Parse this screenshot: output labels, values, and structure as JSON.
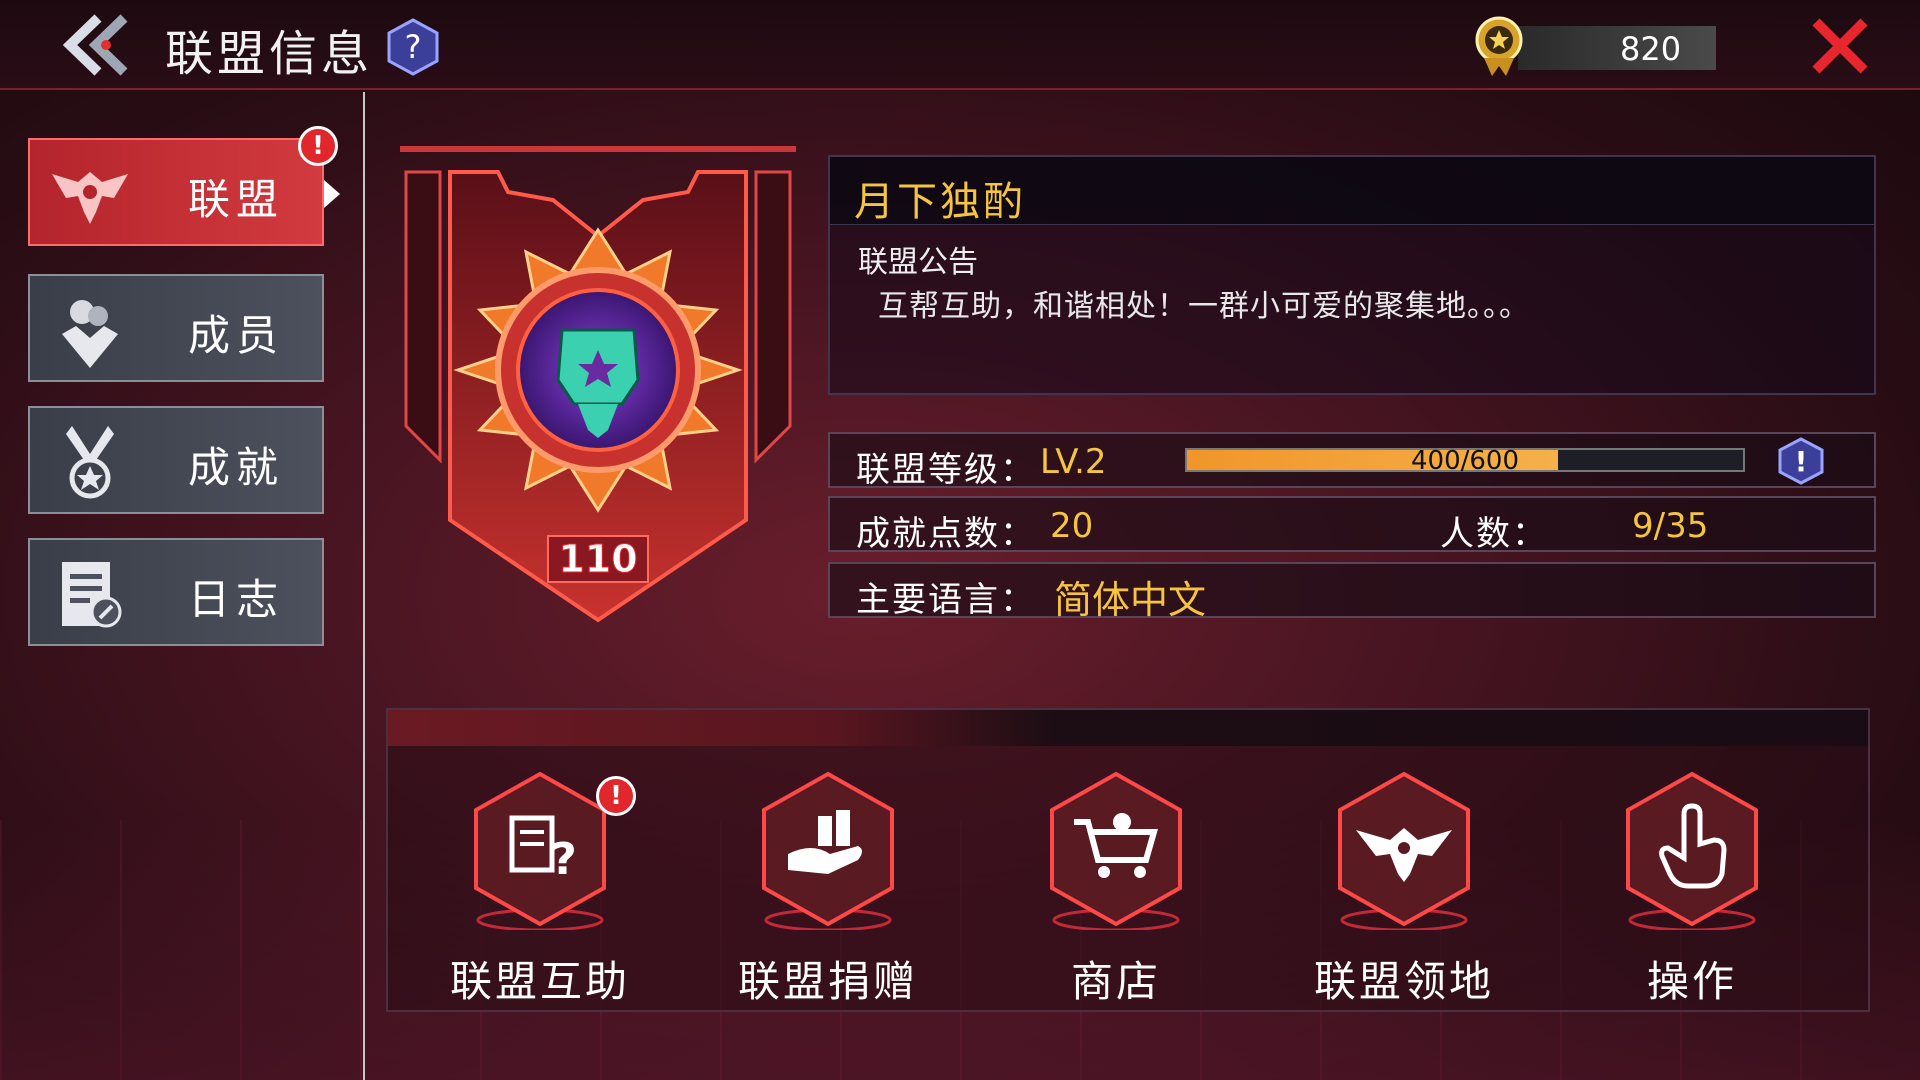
{
  "header": {
    "title": "联盟信息",
    "help_label": "?",
    "currency_value": "820"
  },
  "sidebar": {
    "items": [
      {
        "label": "联盟",
        "active": true,
        "alert": "!"
      },
      {
        "label": "成员",
        "active": false
      },
      {
        "label": "成就",
        "active": false
      },
      {
        "label": "日志",
        "active": false
      }
    ]
  },
  "emblem": {
    "level_text": "110"
  },
  "alliance": {
    "name": "月下独酌",
    "notice_title": "联盟公告",
    "notice_text": "互帮互助，和谐相处！一群小可爱的聚集地。。。",
    "level_label": "联盟等级：",
    "level_value": "LV.2",
    "exp_text": "400/600",
    "exp_progress": 0.667,
    "achievement_label": "成就点数：",
    "achievement_value": "20",
    "members_label": "人数：",
    "members_value": "9/35",
    "language_label": "主要语言：",
    "language_value": "简体中文",
    "info_icon_label": "!"
  },
  "actions": [
    {
      "label": "联盟互助",
      "icon": "help-request-icon",
      "alert": "!"
    },
    {
      "label": "联盟捐赠",
      "icon": "donate-icon"
    },
    {
      "label": "商店",
      "icon": "shop-cart-icon"
    },
    {
      "label": "联盟领地",
      "icon": "territory-icon"
    },
    {
      "label": "操作",
      "icon": "tap-hand-icon"
    }
  ],
  "colors": {
    "accent_gold": "#f5c542",
    "active_red": "#d23b3f",
    "progress_orange": "#f0962a"
  }
}
